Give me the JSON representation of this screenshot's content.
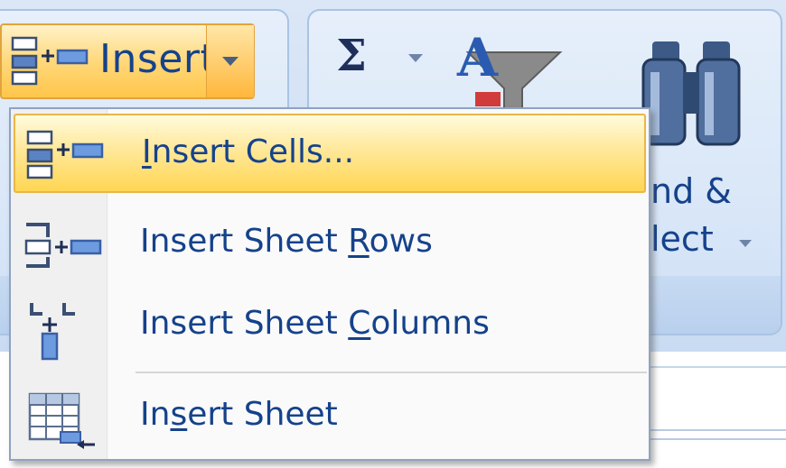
{
  "ribbon": {
    "cells_group": {
      "insert_button_label": "Insert"
    },
    "editing_group": {
      "autosum_glyph": "Σ",
      "sort_filter_glyph": "A",
      "find_select_line1": "nd &",
      "find_select_line2": "lect"
    }
  },
  "insert_menu": {
    "items": [
      {
        "label_before": "",
        "mnemonic": "I",
        "label_after": "nsert Cells...",
        "icon": "insert-cells-icon",
        "highlighted": true
      },
      {
        "label_before": "Insert Sheet ",
        "mnemonic": "R",
        "label_after": "ows",
        "icon": "insert-rows-icon",
        "highlighted": false
      },
      {
        "label_before": "Insert Sheet ",
        "mnemonic": "C",
        "label_after": "olumns",
        "icon": "insert-columns-icon",
        "highlighted": false
      },
      {
        "label_before": "In",
        "mnemonic": "s",
        "label_after": "ert Sheet",
        "icon": "insert-sheet-icon",
        "highlighted": false
      }
    ]
  },
  "colors": {
    "ribbon_text": "#15428b",
    "highlight": "#ffd653",
    "ribbon_background": "#d0e0f4"
  }
}
